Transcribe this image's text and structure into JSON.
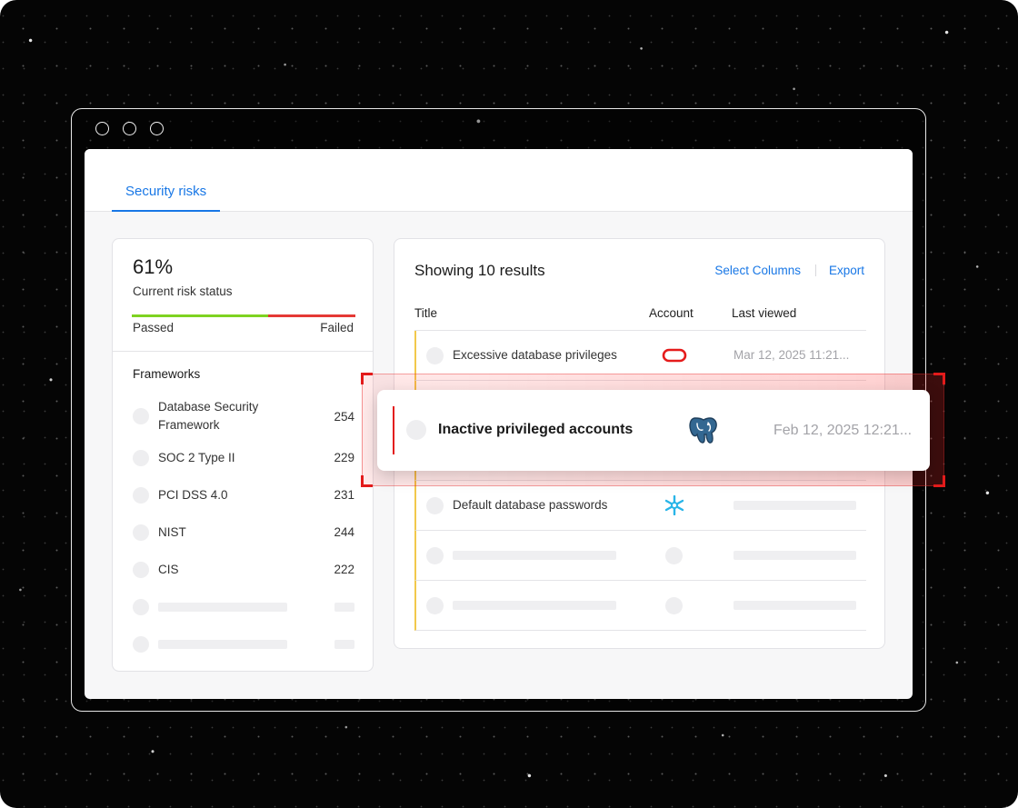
{
  "tabs": [
    {
      "label": "Security risks"
    }
  ],
  "risk": {
    "percent_text": "61%",
    "status_label": "Current risk status",
    "passed_fraction": 0.61,
    "passed_label": "Passed",
    "failed_label": "Failed"
  },
  "frameworks": {
    "heading": "Frameworks",
    "items": [
      {
        "name": "Database Security Framework",
        "count": "254"
      },
      {
        "name": "SOC 2 Type II",
        "count": "229"
      },
      {
        "name": "PCI DSS 4.0",
        "count": "231"
      },
      {
        "name": "NIST",
        "count": "244"
      },
      {
        "name": "CIS",
        "count": "222"
      }
    ]
  },
  "results": {
    "title": "Showing 10 results",
    "select_columns_label": "Select Columns",
    "export_label": "Export",
    "columns": {
      "title": "Title",
      "account": "Account",
      "last_viewed": "Last viewed"
    },
    "rows": [
      {
        "title": "Excessive database privileges",
        "account_icon": "oracle-icon",
        "last_viewed": "Mar 12, 2025 11:21..."
      },
      {
        "title": "Default database passwords",
        "account_icon": "snowflake-icon",
        "last_viewed": ""
      }
    ],
    "highlighted": {
      "title": "Inactive privileged accounts",
      "account_icon": "postgresql-icon",
      "last_viewed": "Feb 12, 2025 12:21..."
    }
  },
  "colors": {
    "accent_blue": "#1877e6",
    "passed_green": "#7ed321",
    "failed_red": "#e53935",
    "row_marker_yellow": "#f2c94c",
    "highlight_red": "#e31b1b"
  }
}
